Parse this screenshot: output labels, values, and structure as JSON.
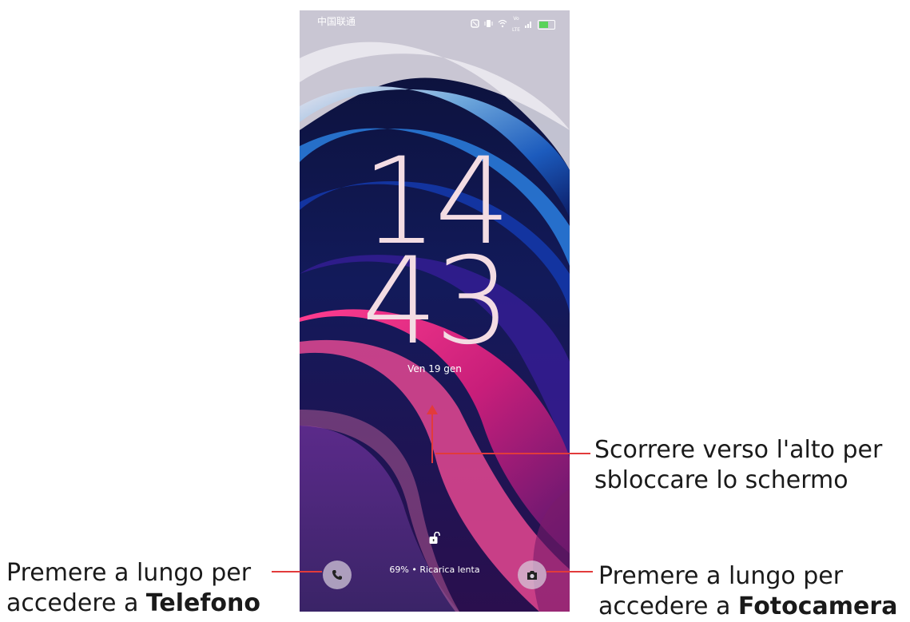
{
  "status_bar": {
    "carrier": "中国联通",
    "icons": [
      "nfc-icon",
      "vibrate-icon",
      "wifi-icon",
      "volte-icon",
      "signal-icon",
      "battery-icon"
    ],
    "network_label_top": "Vo",
    "network_label_bottom": "LTE"
  },
  "lockscreen": {
    "hour": "14",
    "minute": "43",
    "date": "Ven 19 gen",
    "charging_status": "69% • Ricarica lenta",
    "left_shortcut_icon": "phone-icon",
    "right_shortcut_icon": "camera-icon",
    "lock_icon": "unlocked-padlock-icon"
  },
  "callouts": {
    "swipe_line1": "Scorrere verso l'alto per",
    "swipe_line2": "sbloccare lo schermo",
    "phone_line1": "Premere a lungo per",
    "phone_line2_prefix": "accedere a ",
    "phone_line2_bold": "Telefono",
    "camera_line1": "Premere a lungo per",
    "camera_line2_prefix": "accedere a ",
    "camera_line2_bold": "Fotocamera"
  },
  "colors": {
    "callout_line": "#e23b3b",
    "clock_text": "#f3dce3",
    "shortcut_bg": "#d7cddc"
  }
}
